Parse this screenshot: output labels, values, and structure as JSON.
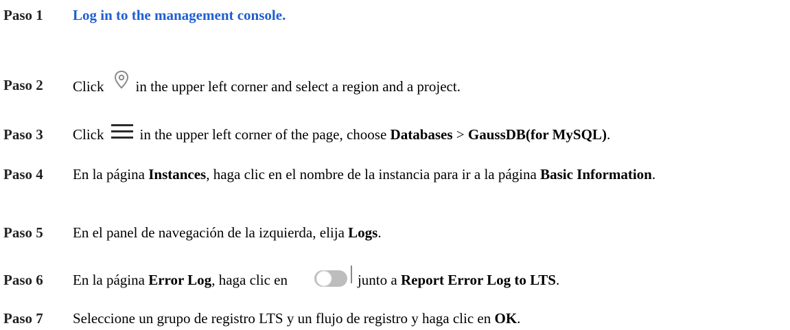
{
  "steps": [
    {
      "label": "Paso 1",
      "link": "Log in to the management console."
    },
    {
      "label": "Paso 2",
      "t1": "Click",
      "icon": "location-pin-icon",
      "t2": "in the upper left corner and select a region and a project."
    },
    {
      "label": "Paso 3",
      "t1": "Click",
      "icon": "hamburger-menu-icon",
      "t2": "in the upper left corner of the page, choose",
      "b1": "Databases",
      "sep": ">",
      "b2": "GaussDB(for MySQL)",
      "end": "."
    },
    {
      "label": "Paso 4",
      "t1": "En la página",
      "b1": "Instances",
      "t2": ", haga clic en el nombre de la instancia para ir a la página",
      "b2": "Basic Information",
      "end": "."
    },
    {
      "label": "Paso 5",
      "t1": "En el panel de navegación de la izquierda, elija",
      "b1": "Logs",
      "end": "."
    },
    {
      "label": "Paso 6",
      "t1": "En la página",
      "b1": "Error Log",
      "t2": ", haga clic en",
      "icon": "toggle-switch-icon",
      "t3": "junto a",
      "b2": "Report Error Log to LTS",
      "end": "."
    },
    {
      "label": "Paso 7",
      "t1": "Seleccione un grupo de registro LTS y un flujo de registro y haga clic en",
      "b1": "OK",
      "end": "."
    }
  ]
}
